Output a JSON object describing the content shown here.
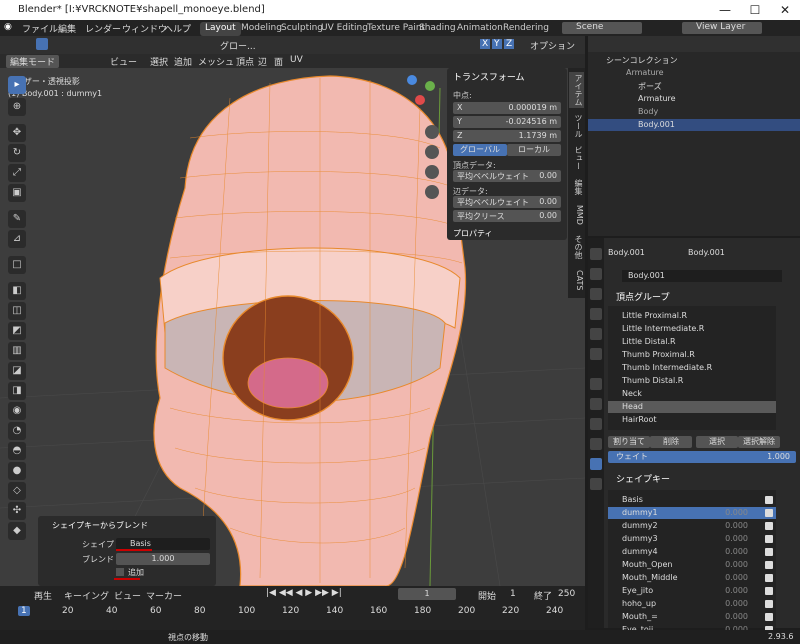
{
  "title": "Blender* [I:¥VRCKNOTE¥shapell_monoeye.blend]",
  "menu": [
    "ファイル",
    "編集",
    "レンダー",
    "ウィンドウ",
    "ヘルプ"
  ],
  "workspaces": [
    "Layout",
    "Modeling",
    "Sculpting",
    "UV Editing",
    "Texture Paint",
    "Shading",
    "Animation",
    "Rendering"
  ],
  "scene": "Scene",
  "view_layer": "View Layer",
  "viewport": {
    "mode": "編集モード",
    "menus": [
      "ビュー",
      "選択",
      "追加",
      "メッシュ",
      "頂点",
      "辺",
      "面",
      "UV"
    ],
    "transform_orient": "グロー...",
    "options": "オプション",
    "info_line1": "ユーザー・透視投影",
    "info_line2": "(1) Body.001 : dummy1",
    "axes": [
      "X",
      "Y",
      "Z"
    ]
  },
  "npanel": {
    "header": "トランスフォーム",
    "center_label": "中点:",
    "x_label": "X",
    "x_val": "0.000019 m",
    "y_label": "Y",
    "y_val": "-0.024516 m",
    "z_label": "Z",
    "z_val": "1.1739 m",
    "global": "グローバル",
    "local": "ローカル",
    "vertex_data": "頂点データ:",
    "mean_bevel_weight": "平均ベベルウェイト",
    "v1": "0.00",
    "edge_data": "辺データ:",
    "mean_bevel_weight2": "平均ベベルウェイト",
    "v2": "0.00",
    "mean_crease": "平均クリース",
    "v3": "0.00",
    "properties": "プロパティ"
  },
  "side_tabs": [
    "アイテム",
    "ツール",
    "ビュー",
    "編集",
    "MMD",
    "その他",
    "CATS"
  ],
  "redo_panel": {
    "header": "シェイプキーからブレンド",
    "shape_label": "シェイプ",
    "shape_val": "Basis",
    "blend_label": "ブレンド",
    "blend_val": "1.000",
    "add_label": "追加"
  },
  "outliner": {
    "root": "シーンコレクション",
    "items": [
      {
        "name": "Armature"
      },
      {
        "name": "ポーズ"
      },
      {
        "name": "Armature"
      },
      {
        "name": "Body"
      },
      {
        "name": "Body.001"
      }
    ]
  },
  "properties": {
    "breadcrumb1": "Body.001",
    "breadcrumb2": "Body.001",
    "mesh_name": "Body.001",
    "vgroups_header": "頂点グループ",
    "vgroups": [
      "Little Proximal.R",
      "Little Intermediate.R",
      "Little Distal.R",
      "Thumb Proximal.R",
      "Thumb Intermediate.R",
      "Thumb Distal.R",
      "Neck",
      "Head",
      "HairRoot"
    ],
    "vg_selected": "Head",
    "assign": "割り当て",
    "remove": "削除",
    "select": "選択",
    "deselect": "選択解除",
    "weight_label": "ウェイト",
    "weight_val": "1.000",
    "shapekeys_header": "シェイプキー",
    "shapekeys": [
      {
        "name": "Basis",
        "val": ""
      },
      {
        "name": "dummy1",
        "val": "0.000"
      },
      {
        "name": "dummy2",
        "val": "0.000"
      },
      {
        "name": "dummy3",
        "val": "0.000"
      },
      {
        "name": "dummy4",
        "val": "0.000"
      },
      {
        "name": "Mouth_Open",
        "val": "0.000"
      },
      {
        "name": "Mouth_Middle",
        "val": "0.000"
      },
      {
        "name": "Eye_jito",
        "val": "0.000"
      },
      {
        "name": "hoho_up",
        "val": "0.000"
      },
      {
        "name": "Mouth_=",
        "val": "0.000"
      },
      {
        "name": "Eye_toji",
        "val": "0.000"
      }
    ]
  },
  "timeline": {
    "menus": [
      "再生",
      "キーイング",
      "ビュー",
      "マーカー"
    ],
    "current_frame": "1",
    "start_label": "開始",
    "start": "1",
    "end_label": "終了",
    "end": "250",
    "ticks": [
      "1",
      "20",
      "40",
      "60",
      "80",
      "100",
      "120",
      "140",
      "160",
      "180",
      "200",
      "220",
      "240"
    ]
  },
  "status": {
    "hint": "視点の移動",
    "version": "2.93.6"
  },
  "colors": {
    "accent": "#4772b3",
    "mesh_edge": "#e8892c",
    "skin": "#f2b9b0",
    "iris": "#8a3e1e"
  }
}
